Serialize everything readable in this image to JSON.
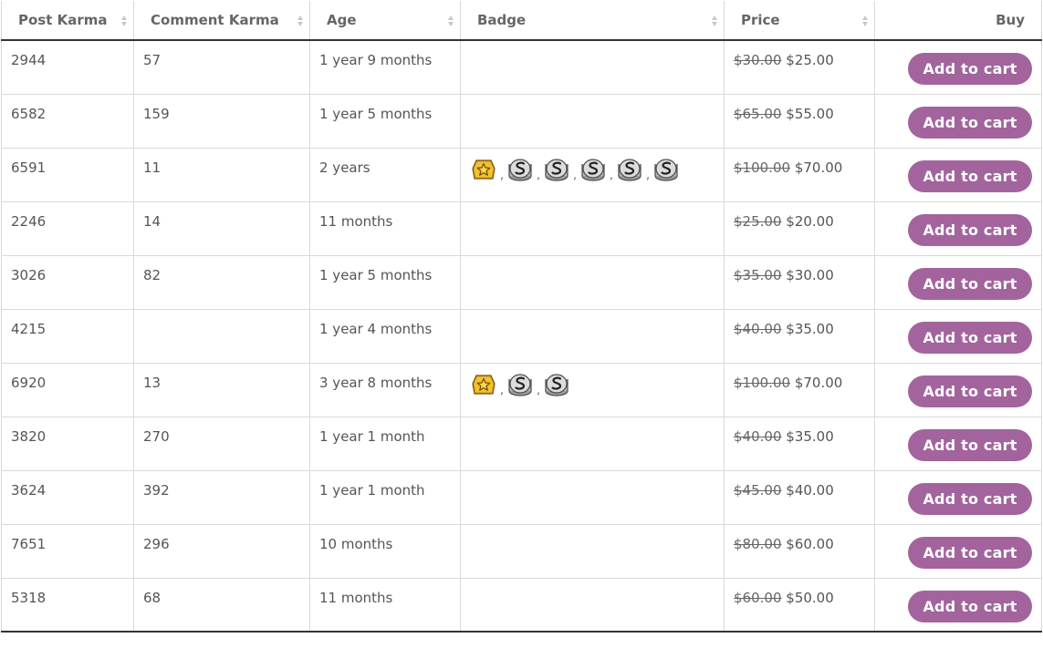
{
  "table": {
    "columns": [
      {
        "key": "post_karma",
        "label": "Post Karma",
        "sortable": true
      },
      {
        "key": "comment_karma",
        "label": "Comment Karma",
        "sortable": true
      },
      {
        "key": "age",
        "label": "Age",
        "sortable": true
      },
      {
        "key": "badge",
        "label": "Badge",
        "sortable": true
      },
      {
        "key": "price",
        "label": "Price",
        "sortable": true
      },
      {
        "key": "buy",
        "label": "Buy",
        "sortable": false
      }
    ],
    "buy_label": "Add to cart",
    "badge_separator": ",",
    "rows": [
      {
        "post_karma": "2944",
        "comment_karma": "57",
        "age": "1 year 9 months",
        "badges": [],
        "price_old": "$30.00",
        "price_new": "$25.00"
      },
      {
        "post_karma": "6582",
        "comment_karma": "159",
        "age": "1 year 5 months",
        "badges": [],
        "price_old": "$65.00",
        "price_new": "$55.00"
      },
      {
        "post_karma": "6591",
        "comment_karma": "11",
        "age": "2 years",
        "badges": [
          "gold-star-badge-icon",
          "silver-s-badge-icon",
          "silver-s-badge-icon",
          "silver-s-badge-icon",
          "silver-s-badge-icon",
          "silver-s-badge-icon"
        ],
        "price_old": "$100.00",
        "price_new": "$70.00"
      },
      {
        "post_karma": "2246",
        "comment_karma": "14",
        "age": "11 months",
        "badges": [],
        "price_old": "$25.00",
        "price_new": "$20.00"
      },
      {
        "post_karma": "3026",
        "comment_karma": "82",
        "age": "1 year 5 months",
        "badges": [],
        "price_old": "$35.00",
        "price_new": "$30.00"
      },
      {
        "post_karma": "4215",
        "comment_karma": "",
        "age": "1 year 4 months",
        "badges": [],
        "price_old": "$40.00",
        "price_new": "$35.00"
      },
      {
        "post_karma": "6920",
        "comment_karma": "13",
        "age": "3 year 8 months",
        "badges": [
          "gold-star-badge-icon",
          "silver-s-badge-icon",
          "silver-s-badge-icon"
        ],
        "price_old": "$100.00",
        "price_new": "$70.00"
      },
      {
        "post_karma": "3820",
        "comment_karma": "270",
        "age": "1 year 1 month",
        "badges": [],
        "price_old": "$40.00",
        "price_new": "$35.00"
      },
      {
        "post_karma": "3624",
        "comment_karma": "392",
        "age": "1 year 1 month",
        "badges": [],
        "price_old": "$45.00",
        "price_new": "$40.00"
      },
      {
        "post_karma": "7651",
        "comment_karma": "296",
        "age": "10 months",
        "badges": [],
        "price_old": "$80.00",
        "price_new": "$60.00"
      },
      {
        "post_karma": "5318",
        "comment_karma": "68",
        "age": "11 months",
        "badges": [],
        "price_old": "$60.00",
        "price_new": "$50.00"
      }
    ]
  },
  "colors": {
    "button_bg": "#a3649e",
    "button_text": "#ffffff",
    "text": "#555555",
    "header_text": "#666666",
    "grid": "#d9d9d9",
    "rule": "#333333",
    "gold_badge": "#f2c230",
    "silver_badge": "#d6d6d6"
  }
}
